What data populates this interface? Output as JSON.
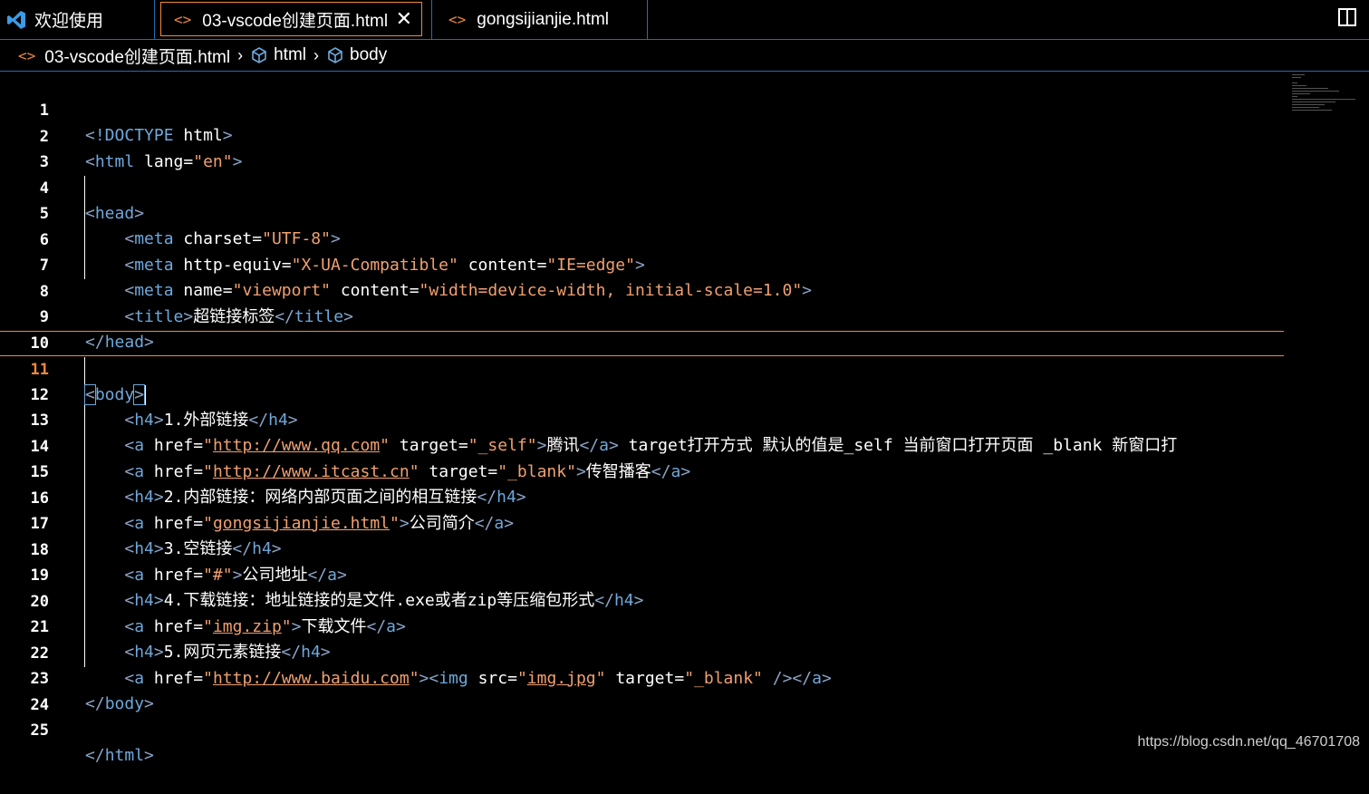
{
  "tabs": [
    {
      "label": "欢迎使用",
      "icon": "vscode-logo-icon"
    },
    {
      "label": "03-vscode创建页面.html",
      "icon": "html-file-icon",
      "active": true,
      "close": "✕"
    },
    {
      "label": "gongsijianjie.html",
      "icon": "html-file-icon"
    }
  ],
  "breadcrumb": {
    "file": "03-vscode创建页面.html",
    "items": [
      "html",
      "body"
    ]
  },
  "editor": {
    "current_line": 11,
    "lines": [
      {
        "n": "1"
      },
      {
        "n": "2"
      },
      {
        "n": "3"
      },
      {
        "n": "4"
      },
      {
        "n": "5"
      },
      {
        "n": "6"
      },
      {
        "n": "7"
      },
      {
        "n": "8"
      },
      {
        "n": "9"
      },
      {
        "n": "10"
      },
      {
        "n": "11"
      },
      {
        "n": "12"
      },
      {
        "n": "13"
      },
      {
        "n": "14"
      },
      {
        "n": "15"
      },
      {
        "n": "16"
      },
      {
        "n": "17"
      },
      {
        "n": "18"
      },
      {
        "n": "19"
      },
      {
        "n": "20"
      },
      {
        "n": "21"
      },
      {
        "n": "22"
      },
      {
        "n": "23"
      },
      {
        "n": "24"
      },
      {
        "n": "25"
      }
    ],
    "text": {
      "doctype": "!DOCTYPE",
      "html": "html",
      "lang": "lang",
      "en": "\"en\"",
      "head": "head",
      "meta": "meta",
      "charset": "charset",
      "utf8": "\"UTF-8\"",
      "http_equiv": "http-equiv",
      "xua": "\"X-UA-Compatible\"",
      "content": "content",
      "ieedge": "\"IE=edge\"",
      "name": "name",
      "viewport": "\"viewport\"",
      "viewport_content": "\"width=device-width, initial-scale=1.0\"",
      "title": "title",
      "title_text": "超链接标签",
      "body": "body",
      "h4": "h4",
      "a": "a",
      "href": "href",
      "target": "target",
      "img": "img",
      "src": "src",
      "h4_1": "1.外部链接",
      "url_qq": "http://www.qq.com",
      "self": "\"_self\"",
      "qq_text": "腾讯",
      "comment13": " target打开方式 默认的值是_self 当前窗口打开页面 _blank 新窗口打",
      "url_itcast": "http://www.itcast.cn",
      "blank": "\"_blank\"",
      "itcast_text": "传智播客",
      "h4_2": "2.内部链接：网络内部页面之间的相互链接",
      "url_gs": "gongsijianjie.html",
      "gs_text": "公司简介",
      "h4_3": "3.空链接",
      "hash": "\"#\"",
      "addr_text": "公司地址",
      "h4_4": "4.下载链接：地址链接的是文件.exe或者zip等压缩包形式",
      "url_zip": "img.zip",
      "zip_text": "下载文件",
      "h4_5": "5.网页元素链接",
      "url_baidu": "http://www.baidu.com",
      "url_jpg": "img.jpg"
    }
  },
  "watermark": "https://blog.csdn.net/qq_46701708",
  "colors": {
    "accent": "#f0883e",
    "tag": "#6fa8dc",
    "string": "#f0a070",
    "border": "#2a6ab0"
  }
}
